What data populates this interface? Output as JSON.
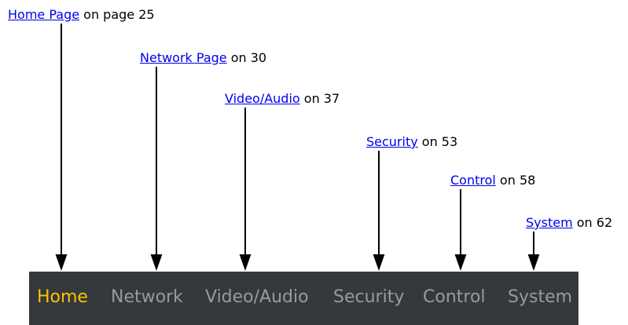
{
  "callouts": [
    {
      "link": "Home Page",
      "rest": " on page 25"
    },
    {
      "link": "Network Page",
      "rest": " on 30"
    },
    {
      "link": "Video/Audio",
      "rest": " on 37"
    },
    {
      "link": "Security",
      "rest": " on 53"
    },
    {
      "link": "Control",
      "rest": " on 58"
    },
    {
      "link": "System",
      "rest": " on 62"
    }
  ],
  "nav": {
    "items": [
      {
        "label": "Home",
        "active": true
      },
      {
        "label": "Network",
        "active": false
      },
      {
        "label": "Video/Audio",
        "active": false
      },
      {
        "label": "Security",
        "active": false
      },
      {
        "label": "Control",
        "active": false
      },
      {
        "label": "System",
        "active": false
      }
    ],
    "colors": {
      "background": "#35383c",
      "active": "#f6c400",
      "inactive": "#9a9a9a",
      "link": "#0000ee"
    }
  }
}
